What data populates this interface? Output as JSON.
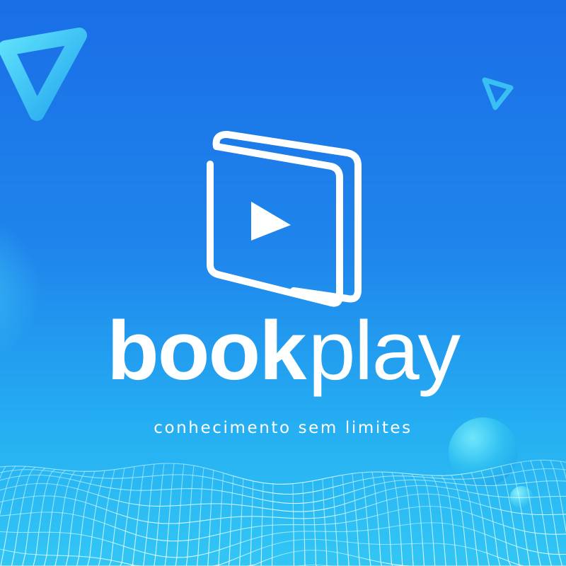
{
  "brand": {
    "name_bold": "book",
    "name_light": "play",
    "tagline": "conhecimento sem limites"
  },
  "icons": {
    "logo": "book-play-icon",
    "play": "play-triangle-icon"
  },
  "colors": {
    "background_top": "#1a6ee6",
    "background_bottom": "#32c6f4",
    "logo": "#ffffff",
    "mesh": "#b8f6ff",
    "accent_cyan": "#3ec9f5"
  }
}
